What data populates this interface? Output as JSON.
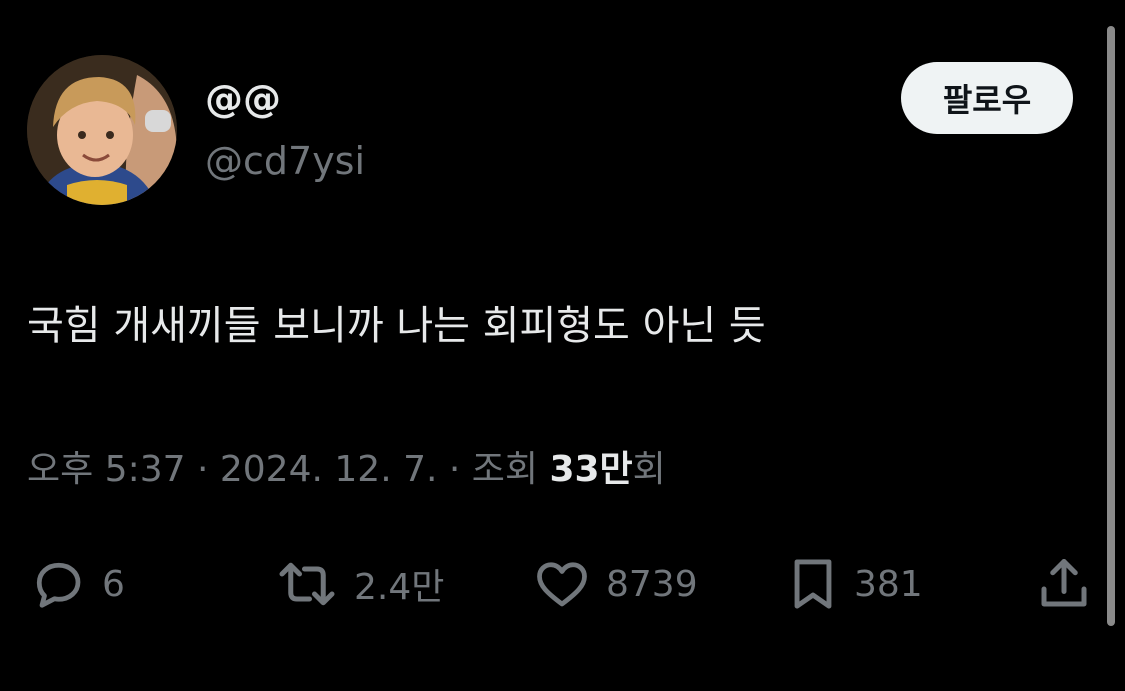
{
  "author": {
    "display_name": "@@",
    "handle": "@cd7ysi"
  },
  "follow_button": {
    "label": "팔로우"
  },
  "tweet": {
    "text": "국힘 개새끼들 보니까 나는 회피형도 아닌 듯"
  },
  "meta": {
    "time": "오후 5:37",
    "separator1": " · ",
    "date": "2024. 12. 7.",
    "separator2": " · ",
    "views_prefix": "조회 ",
    "views_count": "33만",
    "views_suffix": "회"
  },
  "actions": {
    "reply": {
      "icon": "reply-icon",
      "count": "6"
    },
    "retweet": {
      "icon": "retweet-icon",
      "count": "2.4만"
    },
    "like": {
      "icon": "heart-icon",
      "count": "8739"
    },
    "bookmark": {
      "icon": "bookmark-icon",
      "count": "381"
    },
    "share": {
      "icon": "share-icon"
    }
  },
  "colors": {
    "background": "#000000",
    "primary_text": "#e7e9ea",
    "secondary_text": "#71767b",
    "follow_button_bg": "#eff3f4"
  }
}
